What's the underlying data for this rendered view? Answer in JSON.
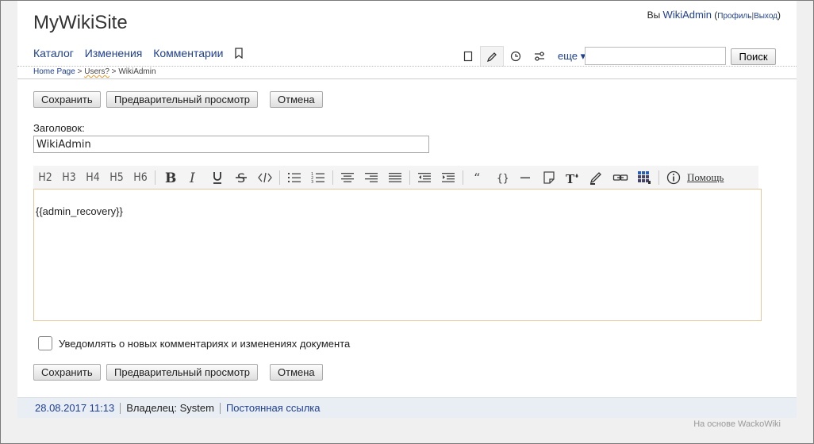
{
  "site": {
    "title": "MyWikiSite"
  },
  "user": {
    "prefix": "Вы",
    "name": "WikiAdmin",
    "profile": "Профиль",
    "logout": "Выход"
  },
  "nav": {
    "items": [
      {
        "label": "Каталог"
      },
      {
        "label": "Изменения"
      },
      {
        "label": "Комментарии"
      }
    ],
    "more_label": "еще ▾",
    "icons": [
      "bookmark-icon",
      "page-icon",
      "pencil-icon",
      "clock-icon",
      "sliders-icon"
    ]
  },
  "search": {
    "value": "",
    "button": "Поиск"
  },
  "breadcrumb": {
    "home": "Home Page",
    "sep1": " > ",
    "users": "Users?",
    "sep2": " > ",
    "current": "WikiAdmin"
  },
  "actions": {
    "save": "Сохранить",
    "preview": "Предварительный просмотр",
    "cancel": "Отмена"
  },
  "form": {
    "title_label": "Заголовок:",
    "title_value": "WikiAdmin",
    "editor_content": "{{admin_recovery}}",
    "notify_label": "Уведомлять о новых комментариях и изменениях документа",
    "notify_checked": false
  },
  "toolbar": {
    "headings": [
      "H2",
      "H3",
      "H4",
      "H5",
      "H6"
    ],
    "help_label": "Помощь"
  },
  "footer": {
    "date": "28.08.2017 11:13",
    "owner": "Владелец: System",
    "permalink": "Постоянная ссылка",
    "powered": "На основе WackoWiki"
  }
}
